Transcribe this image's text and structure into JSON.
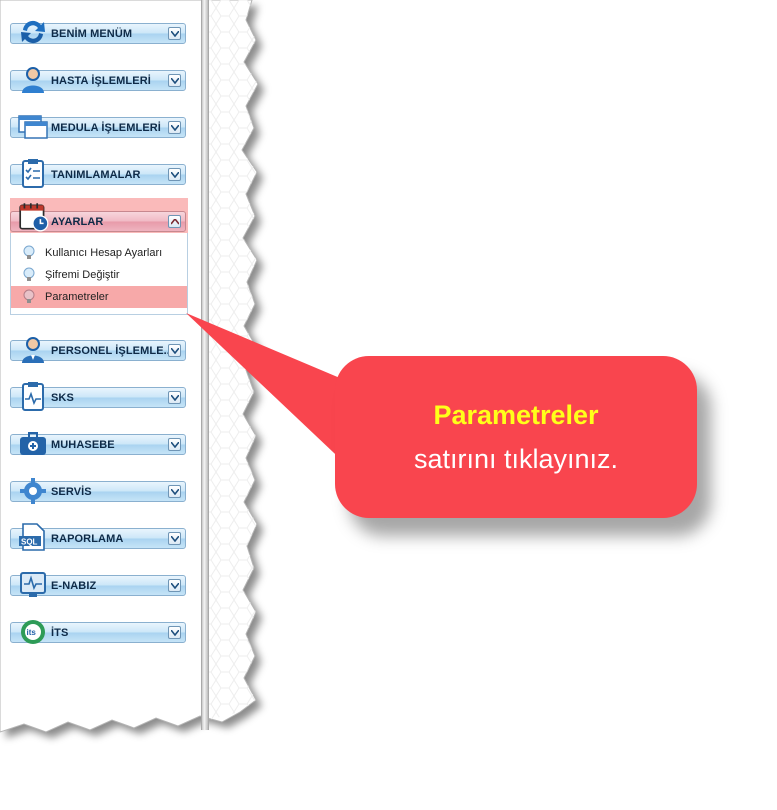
{
  "menu": {
    "items": [
      {
        "label": "BENİM MENÜM",
        "icon": "refresh-arrows-icon"
      },
      {
        "label": "HASTA İŞLEMLERİ",
        "icon": "patient-icon"
      },
      {
        "label": "MEDULA İŞLEMLERİ",
        "icon": "windows-icon"
      },
      {
        "label": "TANIMLAMALAR",
        "icon": "clipboard-checklist-icon"
      },
      {
        "label": "AYARLAR",
        "icon": "calendar-clock-icon"
      },
      {
        "label": "PERSONEL İŞLEMLE...",
        "icon": "staff-icon"
      },
      {
        "label": "SKS",
        "icon": "clipboard-pulse-icon"
      },
      {
        "label": "MUHASEBE",
        "icon": "medical-case-icon"
      },
      {
        "label": "SERVİS",
        "icon": "gear-icon"
      },
      {
        "label": "RAPORLAMA",
        "icon": "sql-document-icon"
      },
      {
        "label": "E-NABIZ",
        "icon": "monitor-pulse-icon"
      },
      {
        "label": "İTS",
        "icon": "its-logo-icon"
      }
    ],
    "active_index": 4,
    "submenu": [
      {
        "label": "Kullanıcı Hesap Ayarları"
      },
      {
        "label": "Şifremi Değiştir"
      },
      {
        "label": "Parametreler",
        "selected": true
      }
    ]
  },
  "callout": {
    "highlight": "Parametreler",
    "text": "satırını tıklayınız."
  },
  "colors": {
    "callout_bg": "#f9454e",
    "callout_highlight": "#ffff1a",
    "active_row": "#f48c8c",
    "button_blue": "#a9d3f0"
  }
}
